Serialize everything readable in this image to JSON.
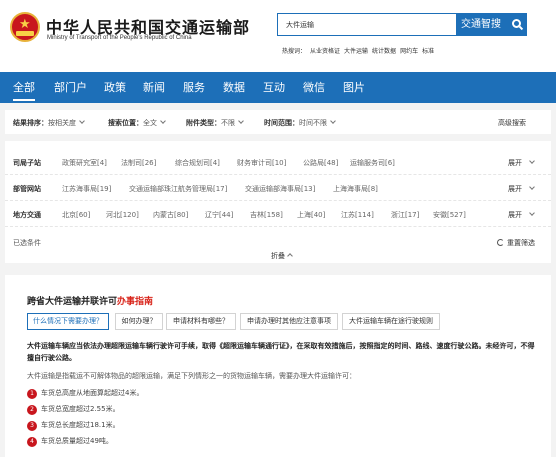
{
  "header": {
    "title": "中华人民共和国交通运输部",
    "subtitle": "Ministry of Transport of the People's Republic of China",
    "search_value": "大件运输",
    "search_button": "交通智搜",
    "hot_label": "热搜词：",
    "hot_terms": [
      "从业资格证",
      "大件运输",
      "统计数据",
      "网约车",
      "标准"
    ]
  },
  "nav": {
    "items": [
      "全部",
      "部门户",
      "政策",
      "新闻",
      "服务",
      "数据",
      "互动",
      "微信",
      "图片"
    ],
    "active_index": 0
  },
  "filters": {
    "sort_label": "结果排序：",
    "sort_value": "按相关度",
    "position_label": "搜索位置：",
    "position_value": "全文",
    "attachment_label": "附件类型：",
    "attachment_value": "不限",
    "time_label": "时间范围：",
    "time_value": "时间不限",
    "advanced": "高级搜索"
  },
  "categories": {
    "rows": [
      {
        "label": "司局子站",
        "options": [
          "政策研究室[4]",
          "法制司[26]",
          "综合规划司[4]",
          "财务审计司[10]",
          "公路局[48]",
          "运输服务司[6]"
        ]
      },
      {
        "label": "部管网站",
        "options": [
          "江苏海事局[19]",
          "交通运输部珠江航务管理局[17]",
          "交通运输部海事局[13]",
          "上海海事局[8]"
        ]
      },
      {
        "label": "地方交通",
        "options": [
          "北京[60]",
          "河北[120]",
          "内蒙古[80]",
          "辽宁[44]",
          "吉林[158]",
          "上海[40]",
          "江苏[114]",
          "浙江[17]",
          "安徽[527]"
        ]
      }
    ],
    "expand_label": "展开",
    "selected_label": "已选条件",
    "reset_label": "重置筛选",
    "collapse_label": "折叠"
  },
  "guide": {
    "title_main": "跨省大件运输并联许可",
    "title_highlight": "办事指南",
    "tabs": [
      "什么情况下需要办理？",
      "如何办理？",
      "申请材料有哪些？",
      "申请办理时其他应注意事项",
      "大件运输车辆在途行驶规则"
    ],
    "active_tab": 0,
    "para1": "大件运输车辆应当依法办理超限运输车辆行驶许可手续，取得《超限运输车辆通行证》，在采取有效措施后，按照指定的时间、路线、速度行驶公路。未经许可，不得擅自行驶公路。",
    "para2": "大件运输是指载运不可解体物品的超限运输，满足下列情形之一的货物运输车辆，需要办理大件运输许可：",
    "conditions": [
      {
        "num": "1",
        "text": "车货总高度从地面算起超过4米。"
      },
      {
        "num": "2",
        "text": "车货总宽度超过2.55米。"
      },
      {
        "num": "3",
        "text": "车货总长度超过18.1米。"
      },
      {
        "num": "4",
        "text": "车货总质量超过49吨。"
      }
    ]
  },
  "colors": {
    "brand_blue": "#1d6fb8",
    "accent_red": "#d9261c",
    "page_bg": "#f3f3f3"
  }
}
